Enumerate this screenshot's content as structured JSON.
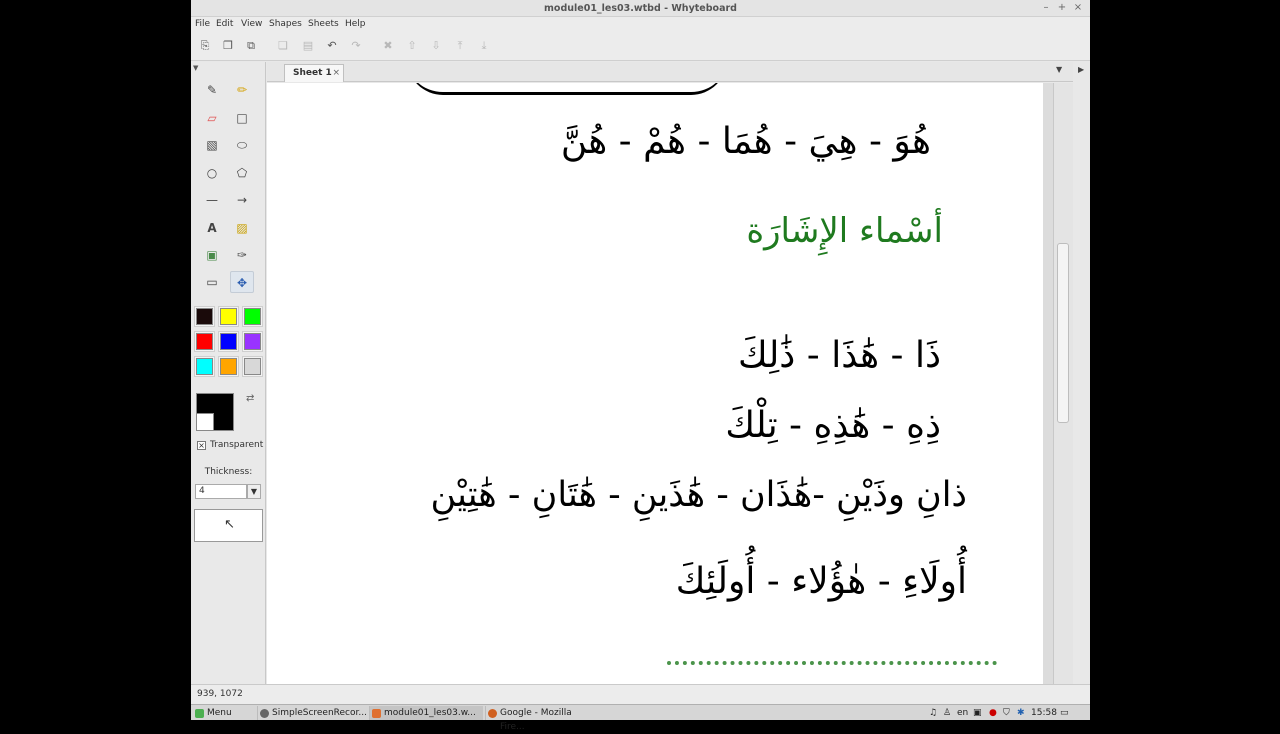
{
  "window": {
    "title": "module01_les03.wtbd - Whyteboard",
    "minimize": "–",
    "maximize": "+",
    "close": "×"
  },
  "menu": [
    "File",
    "Edit",
    "View",
    "Shapes",
    "Sheets",
    "Help"
  ],
  "toolbar": {
    "icons": [
      "new-icon",
      "open-icon",
      "save-icon",
      "copy-icon",
      "paste-icon",
      "undo-icon",
      "redo-icon",
      "delete-icon",
      "move-up-icon",
      "move-down-icon",
      "move-top-icon",
      "move-bottom-icon"
    ]
  },
  "tools": {
    "names": [
      "pen",
      "highlighter",
      "eraser",
      "rectangle",
      "rounded-rectangle",
      "ellipse",
      "circle",
      "polygon",
      "line",
      "arrow",
      "text",
      "note",
      "image",
      "eyedropper",
      "select",
      "pan"
    ]
  },
  "palette": {
    "colors": [
      "#1a0a0a",
      "#ffff00",
      "#00ff00",
      "#ff0000",
      "#0000ff",
      "#9933ff",
      "#00ffff",
      "#ffa500",
      "#d8d8d8"
    ]
  },
  "color": {
    "foreground": "#000000",
    "background": "#ffffff",
    "transparent_label": "Transparent",
    "transparent_checked": true
  },
  "thickness": {
    "label": "Thickness:",
    "value": "4"
  },
  "tabs": [
    {
      "label": "Sheet 1",
      "close": "×"
    }
  ],
  "canvas": {
    "lines": [
      {
        "text": "هُوَ - هِيَ - هُمَا - هُمْ - هُنَّ",
        "color": "black"
      },
      {
        "text": "أسْماء الإِشَارَة",
        "color": "green"
      },
      {
        "text": "ذَا - هَٰذَا - ذَٰلِكَ",
        "color": "black"
      },
      {
        "text": "ذِهِ - هَٰذِهِ - تِلْكَ",
        "color": "black"
      },
      {
        "text": "ذانِ وذَيْنِ -هَٰذَان - هَٰذَينِ - هَٰتَانِ - هَٰتِيْنِ",
        "color": "black"
      },
      {
        "text": "أُولَاءِ - هٰؤُلاء - أُولَئِكَ",
        "color": "black"
      }
    ]
  },
  "status": {
    "coords": "939, 1072"
  },
  "taskbar": {
    "menu": "Menu",
    "tasks": [
      "SimpleScreenRecor...",
      "module01_les03.w...",
      "Google - Mozilla Fire..."
    ],
    "lang": "en",
    "time": "15:58"
  }
}
